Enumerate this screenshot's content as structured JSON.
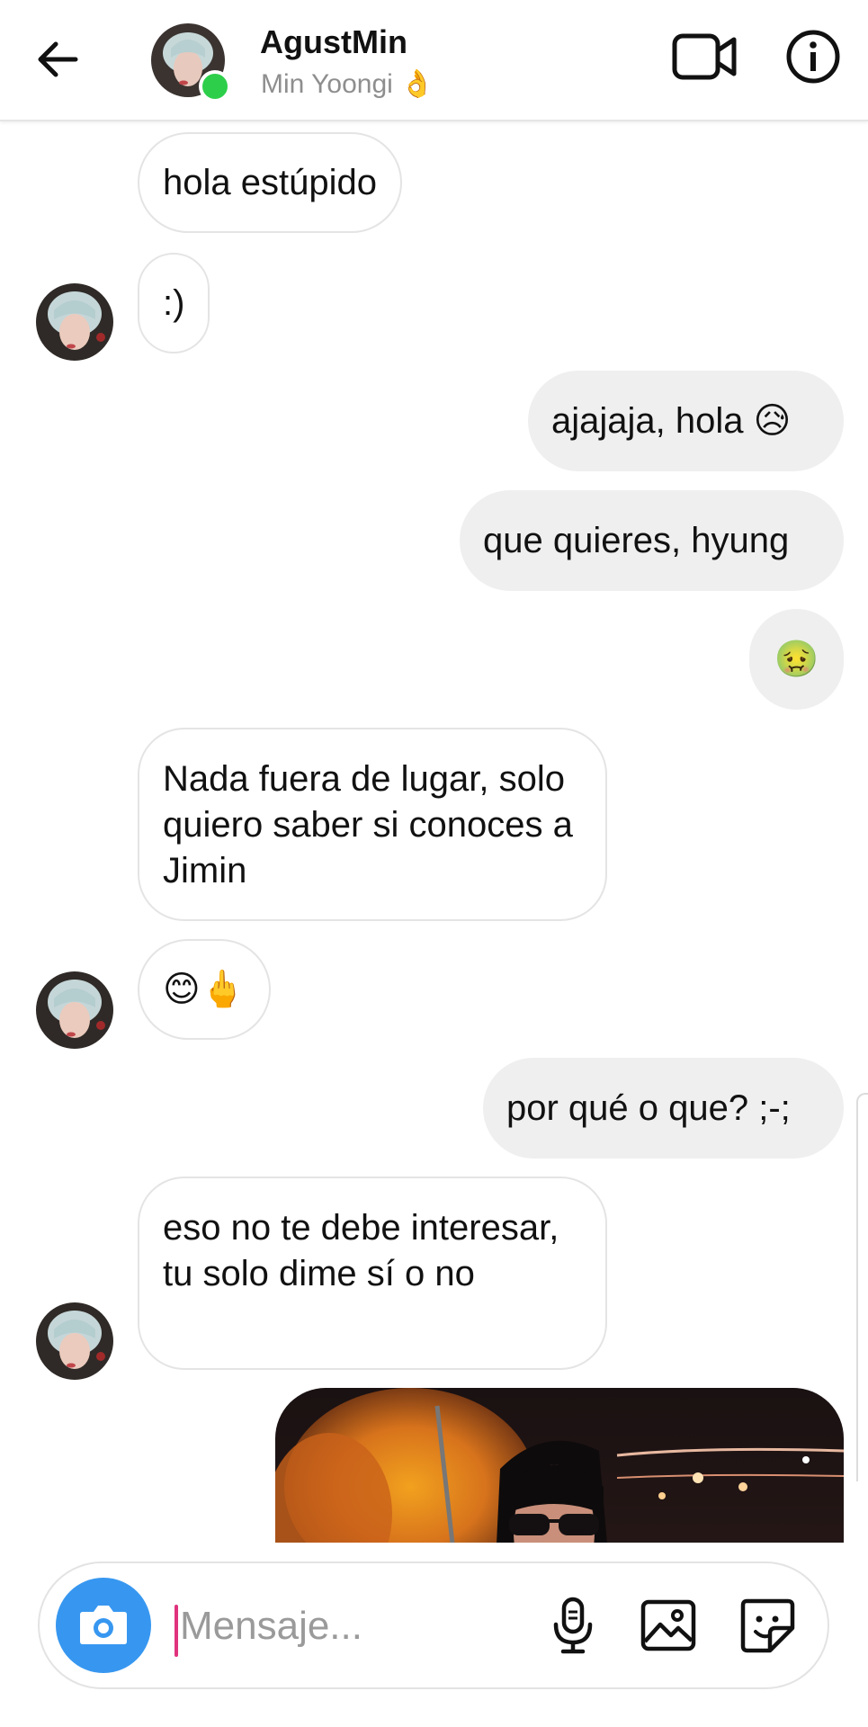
{
  "header": {
    "contact_name": "AgustMin",
    "contact_subtitle": "Min Yoongi 👌",
    "back_icon": "arrow-left-icon",
    "video_icon": "video-camera-icon",
    "info_icon": "info-icon",
    "online_color": "#2dcf4a"
  },
  "messages": [
    {
      "sender": "them",
      "text": "hola estúpido"
    },
    {
      "sender": "them",
      "text": ":)"
    },
    {
      "sender": "me",
      "text": "ajajaja, hola",
      "emoji": "😥"
    },
    {
      "sender": "me",
      "text": "que quieres, hyung"
    },
    {
      "sender": "me",
      "text": "🤢"
    },
    {
      "sender": "them",
      "text": "Nada fuera de lugar, solo quiero saber si conoces a Jimin"
    },
    {
      "sender": "them",
      "text": "😊🖕"
    },
    {
      "sender": "me",
      "text": "por qué o que? ;-;"
    },
    {
      "sender": "them",
      "text": "eso no te debe interesar, tu solo dime sí o no"
    },
    {
      "sender": "me",
      "type": "image",
      "description_icon": "photo-message"
    }
  ],
  "composer": {
    "placeholder": "Mensaje...",
    "value": "",
    "camera_icon": "camera-icon",
    "mic_icon": "microphone-icon",
    "gallery_icon": "gallery-icon",
    "sticker_icon": "sticker-icon",
    "accent": "#3797f0"
  }
}
